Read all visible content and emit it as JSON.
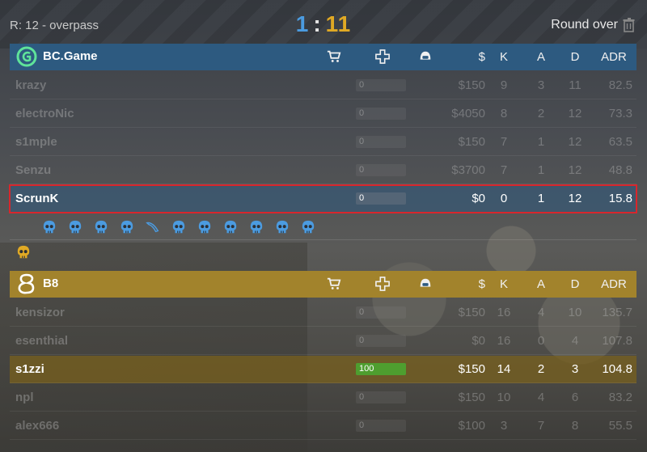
{
  "round_label": "R: 12 - overpass",
  "score": {
    "ct": "1",
    "separator": ":",
    "t": "11"
  },
  "round_status": "Round over",
  "columns": {
    "money": "$",
    "kills": "K",
    "assists": "A",
    "deaths": "D",
    "adr": "ADR"
  },
  "icons": [
    "shop-cart-icon",
    "health-cross-icon",
    "helmet-icon",
    "skull-icon",
    "knife-icon",
    "trash-icon",
    "team-logo-icon"
  ],
  "colors": {
    "ct": "#4b9be0",
    "t": "#e0a924",
    "selected_outline": "#d8262c",
    "hp_fill": "#4e9e2f"
  },
  "teams": [
    {
      "name": "BC.Game",
      "side": "ct",
      "players": [
        {
          "name": "krazy",
          "hp": "0",
          "hp_fraction": 0,
          "money": "$150",
          "k": "9",
          "a": "3",
          "d": "11",
          "adr": "82.5"
        },
        {
          "name": "electroNic",
          "hp": "0",
          "hp_fraction": 0,
          "money": "$4050",
          "k": "8",
          "a": "2",
          "d": "12",
          "adr": "73.3"
        },
        {
          "name": "s1mple",
          "hp": "0",
          "hp_fraction": 0,
          "money": "$150",
          "k": "7",
          "a": "1",
          "d": "12",
          "adr": "63.5"
        },
        {
          "name": "Senzu",
          "hp": "0",
          "hp_fraction": 0,
          "money": "$3700",
          "k": "7",
          "a": "1",
          "d": "12",
          "adr": "48.8"
        },
        {
          "name": "ScrunK",
          "hp": "0",
          "hp_fraction": 0,
          "money": "$0",
          "k": "0",
          "a": "1",
          "d": "12",
          "adr": "15.8"
        }
      ],
      "round_kills": [
        "skull",
        "skull",
        "skull",
        "skull",
        "knife",
        "skull",
        "skull",
        "skull",
        "skull",
        "skull",
        "skull"
      ]
    },
    {
      "name": "B8",
      "side": "t",
      "players": [
        {
          "name": "kensizor",
          "hp": "0",
          "hp_fraction": 0,
          "money": "$150",
          "k": "16",
          "a": "4",
          "d": "10",
          "adr": "135.7"
        },
        {
          "name": "esenthial",
          "hp": "0",
          "hp_fraction": 0,
          "money": "$0",
          "k": "16",
          "a": "0",
          "d": "4",
          "adr": "107.8"
        },
        {
          "name": "s1zzi",
          "hp": "100",
          "hp_fraction": 1,
          "money": "$150",
          "k": "14",
          "a": "2",
          "d": "3",
          "adr": "104.8"
        },
        {
          "name": "npl",
          "hp": "0",
          "hp_fraction": 0,
          "money": "$150",
          "k": "10",
          "a": "4",
          "d": "6",
          "adr": "83.2"
        },
        {
          "name": "alex666",
          "hp": "0",
          "hp_fraction": 0,
          "money": "$100",
          "k": "3",
          "a": "7",
          "d": "8",
          "adr": "55.5"
        }
      ],
      "round_kills": [
        "skull"
      ]
    }
  ]
}
